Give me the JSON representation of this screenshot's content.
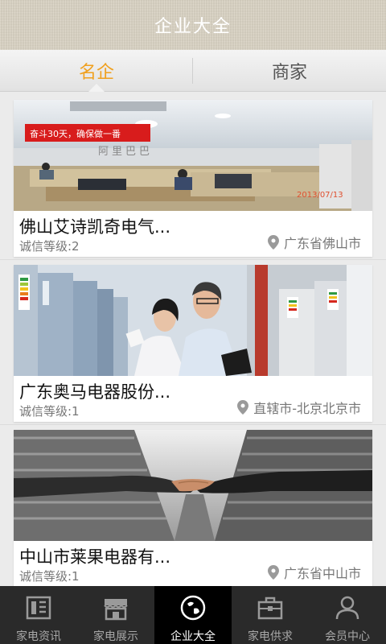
{
  "header": {
    "title": "企业大全"
  },
  "tabs": [
    {
      "label": "名企",
      "active": true
    },
    {
      "label": "商家",
      "active": false
    }
  ],
  "companies": [
    {
      "name": "佛山艾诗凯奇电气...",
      "grade": "诚信等级:2",
      "location": "广东省佛山市",
      "photo_banner": "奋斗30天，确保做一番",
      "photo_wall_text": "阿里巴巴",
      "photo_date": "2013/07/13"
    },
    {
      "name": "广东奥马电器股份...",
      "grade": "诚信等级:1",
      "location": "直辖市-北京北京市"
    },
    {
      "name": "中山市莱果电器有...",
      "grade": "诚信等级:1",
      "location": "广东省中山市"
    }
  ],
  "bottom_nav": [
    {
      "label": "家电资讯",
      "icon": "news-icon",
      "active": false
    },
    {
      "label": "家电展示",
      "icon": "shop-icon",
      "active": false
    },
    {
      "label": "企业大全",
      "icon": "globe-icon",
      "active": true
    },
    {
      "label": "家电供求",
      "icon": "briefcase-icon",
      "active": false
    },
    {
      "label": "会员中心",
      "icon": "user-icon",
      "active": false
    }
  ],
  "colors": {
    "accent": "#f0a01e",
    "bottom_bar": "#2a2a2a",
    "bottom_active": "#000000"
  }
}
